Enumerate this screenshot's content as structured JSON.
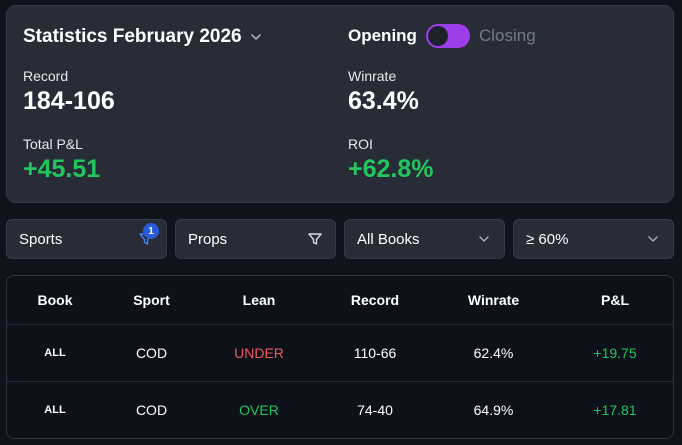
{
  "header": {
    "title": "Statistics February 2026",
    "toggle": {
      "left_label": "Opening",
      "right_label": "Closing",
      "state": "on",
      "accent": "#9c3fe8"
    }
  },
  "stats": {
    "record": {
      "label": "Record",
      "value": "184-106"
    },
    "winrate": {
      "label": "Winrate",
      "value": "63.4%"
    },
    "pnl": {
      "label": "Total P&L",
      "value": "+45.51"
    },
    "roi": {
      "label": "ROI",
      "value": "+62.8%"
    }
  },
  "filters": {
    "sports": {
      "label": "Sports",
      "badge": "1",
      "icon": "filter-icon"
    },
    "props": {
      "label": "Props",
      "icon": "filter-icon"
    },
    "books": {
      "label": "All Books",
      "icon": "chevron-down-icon"
    },
    "winrate": {
      "label": "≥ 60%",
      "icon": "chevron-down-icon"
    }
  },
  "table": {
    "headers": [
      "Book",
      "Sport",
      "Lean",
      "Record",
      "Winrate",
      "P&L"
    ],
    "rows": [
      {
        "book": "ALL",
        "sport": "COD",
        "lean": "UNDER",
        "record": "110-66",
        "winrate": "62.4%",
        "pnl": "+19.75"
      },
      {
        "book": "ALL",
        "sport": "COD",
        "lean": "OVER",
        "record": "74-40",
        "winrate": "64.9%",
        "pnl": "+17.81"
      }
    ]
  },
  "colors": {
    "positive": "#22c55e",
    "negative": "#f05a63",
    "badge": "#2a5bd8"
  }
}
